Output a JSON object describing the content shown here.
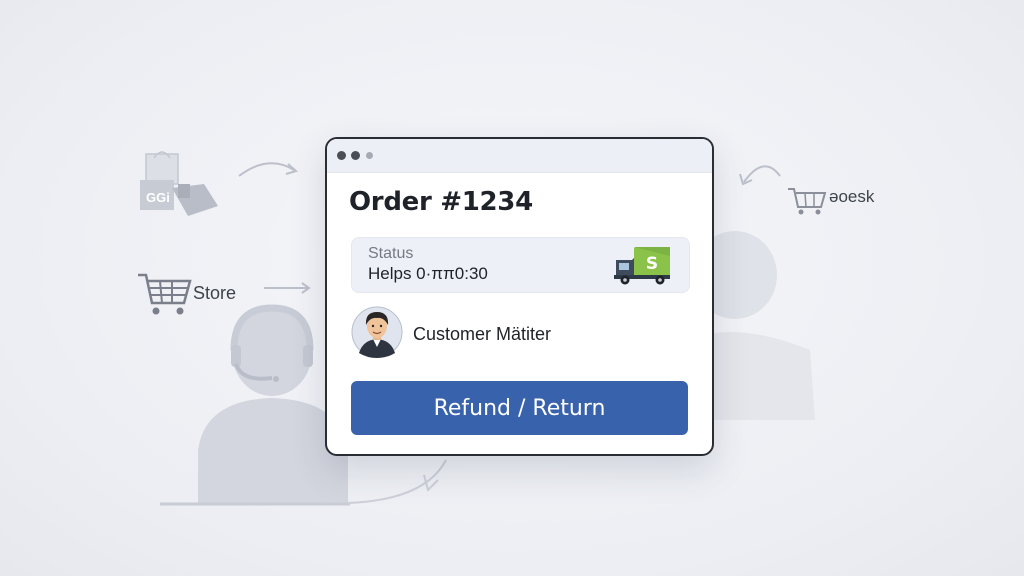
{
  "background": {
    "store_label": "Store",
    "desk_label": "əoesk",
    "bag_label": "GGi"
  },
  "window": {
    "order_title": "Order #1234",
    "status_label": "Status",
    "status_value": "Helps 0·ππ0:30",
    "truck_badge": "S",
    "customer_name": "Customer Mätiter",
    "refund_button": "Refund / Return"
  },
  "colors": {
    "accent": "#3962ad",
    "truck_green": "#8bc34a",
    "background": "#eceef3"
  }
}
